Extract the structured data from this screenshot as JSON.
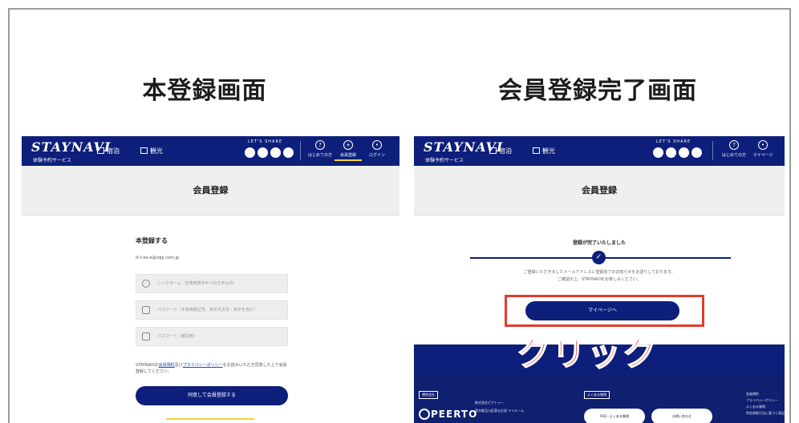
{
  "headings": {
    "left": "本登録画面",
    "right": "会員登録完了画面"
  },
  "site": {
    "logo": "STAYNAVI",
    "logo_sub": "体験予約サービス",
    "nav_stay": "宿泊",
    "nav_sightseeing": "観光",
    "share_label": "LET'S SHARE",
    "header_guide": "はじめての方",
    "header_register": "会員登録",
    "header_login": "ログイン",
    "header_mypage": "マイページ"
  },
  "left_screen": {
    "page_title": "会員登録",
    "form_title": "本登録する",
    "email_line": "✉ t-ex-e@sdjp.com.jp",
    "fields": [
      "ニックネーム（全角英数字4～20文字以内）",
      "パスワード（半角英数記号、英字大文字・数字を含む）",
      "パスワード（確認用）"
    ],
    "terms_prefix": "STAYNAVIの",
    "terms_link1": "会員規約",
    "terms_mid": "及び",
    "terms_link2": "プライバシーポリシー",
    "terms_suffix": "をお読みいただき同意した上で会員登録してください。",
    "submit_label": "同意して会員登録する"
  },
  "right_screen": {
    "page_title": "会員登録",
    "done_title": "登録が完了いたしました",
    "check_icon": "✓",
    "done_message_line1": "ご登録いただきましたメールアドレスに登録完了のお知らせをお送りしております。",
    "done_message_line2": "ご確認の上、STAYNAVIをお楽しみください。",
    "mypage_button": "マイページへ",
    "click_label": "クリック",
    "footer_tag1": "運営会社",
    "footer_tag2": "よくある質問",
    "company_name": "株式会社ピアトゥー",
    "company_address": "東京都品川区東五反田 マイルーム",
    "brand": "PEERTO",
    "faq_button": "FAQ・よくある質問",
    "contact_button": "お問い合わせ",
    "footer_links": [
      "会員規約",
      "プライバシーポリシー",
      "よくある質問",
      "特定商取引法に基づく表記"
    ]
  },
  "colors": {
    "navy": "#0d1f7a",
    "accent_red": "#e23b2c",
    "accent_yellow": "#f6d33c"
  }
}
